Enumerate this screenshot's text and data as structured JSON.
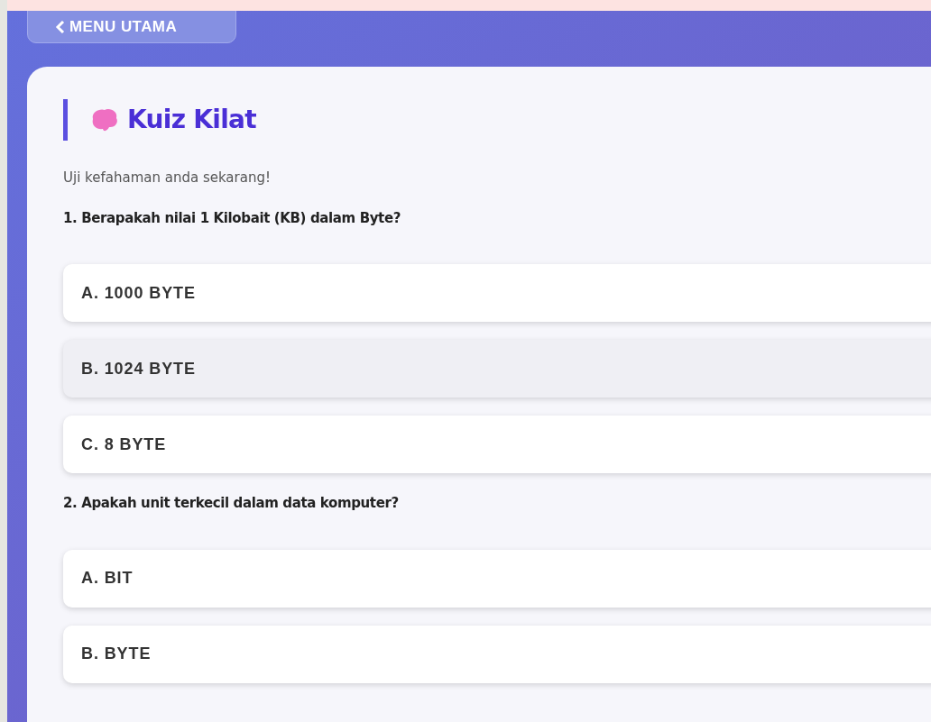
{
  "back_button": {
    "label": "MENU UTAMA"
  },
  "quiz": {
    "title": "Kuiz Kilat",
    "subtitle": "Uji kefahaman anda sekarang!",
    "questions": [
      {
        "text": "1. Berapakah nilai 1 Kilobait (KB) dalam Byte?",
        "options": [
          {
            "label": "A. 1000 BYTE",
            "selected": false
          },
          {
            "label": "B. 1024 BYTE",
            "selected": true
          },
          {
            "label": "C. 8 BYTE",
            "selected": false
          }
        ]
      },
      {
        "text": "2. Apakah unit terkecil dalam data komputer?",
        "options": [
          {
            "label": "A. BIT",
            "selected": false
          },
          {
            "label": "B. BYTE",
            "selected": false
          }
        ]
      }
    ]
  }
}
